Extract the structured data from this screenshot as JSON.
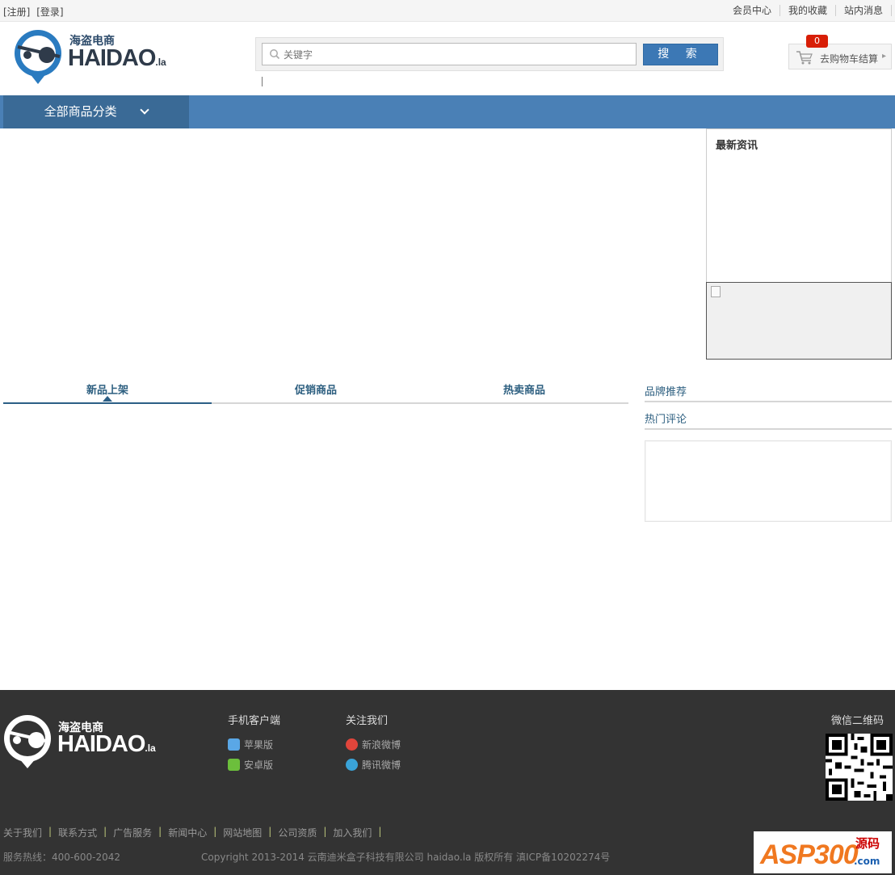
{
  "topbar": {
    "register": "[注册]",
    "login": "[登录]",
    "links": [
      "会员中心",
      "我的收藏",
      "站内消息"
    ]
  },
  "logo": {
    "zh": "海盗电商",
    "en": "HAIDAO",
    "suffix": ".la"
  },
  "search": {
    "placeholder": "关键字",
    "button": "搜 索"
  },
  "cart": {
    "label": "去购物车结算",
    "count": "0"
  },
  "nav": {
    "all_categories": "全部商品分类"
  },
  "news": {
    "title": "最新资讯"
  },
  "tabs": [
    {
      "label": "新品上架",
      "active": true
    },
    {
      "label": "促销商品",
      "active": false
    },
    {
      "label": "热卖商品",
      "active": false
    }
  ],
  "side": {
    "brand": "品牌推荐",
    "comments": "热门评论"
  },
  "footer": {
    "logo_zh": "海盗电商",
    "logo_en": "HAIDAO",
    "logo_suffix": ".la",
    "mobile": {
      "title": "手机客户端",
      "items": [
        "苹果版",
        "安卓版"
      ]
    },
    "follow": {
      "title": "关注我们",
      "items": [
        "新浪微博",
        "腾讯微博"
      ]
    },
    "qr_title": "微信二维码",
    "links": [
      "关于我们",
      "联系方式",
      "广告服务",
      "新闻中心",
      "网站地图",
      "公司资质",
      "加入我们"
    ],
    "hotline": "服务热线：400-600-2042",
    "copyright": "Copyright 2013-2014 云南迪米盒子科技有限公司 haidao.la 版权所有 滇ICP备10202274号"
  },
  "watermark": {
    "main": "ASP300",
    "zh": "源码",
    "dom": ".com"
  },
  "colors": {
    "nav": "#4a80b6",
    "nav_dark": "#3a6a96",
    "footer": "#333333",
    "accent": "#2c5f86",
    "badge": "#d81e06"
  }
}
